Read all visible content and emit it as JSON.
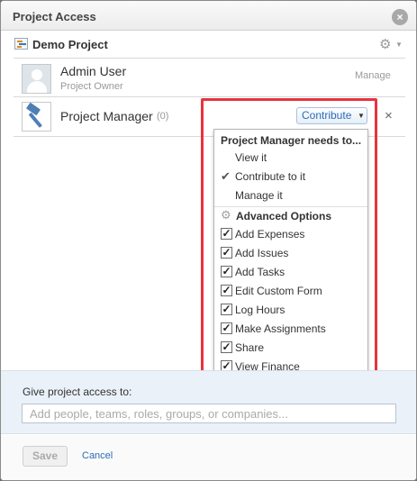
{
  "dialog": {
    "title": "Project Access",
    "close_glyph": "×"
  },
  "project": {
    "name": "Demo Project",
    "icon": "project-icon",
    "settings_icon": "gear-icon"
  },
  "members": [
    {
      "name": "Admin User",
      "subtitle": "Project Owner",
      "access": "Manage",
      "icon": "avatar-placeholder"
    },
    {
      "name": "Project Manager",
      "count": "(0)",
      "access": "Contribute",
      "icon": "hammer-icon",
      "remove_glyph": "×"
    }
  ],
  "menu": {
    "header": "Project Manager needs to...",
    "options": [
      {
        "label": "View it",
        "selected": false
      },
      {
        "label": "Contribute to it",
        "selected": true
      },
      {
        "label": "Manage it",
        "selected": false
      }
    ],
    "advanced_label": "Advanced Options",
    "advanced": [
      {
        "label": "Add Expenses",
        "checked": true
      },
      {
        "label": "Add Issues",
        "checked": true
      },
      {
        "label": "Add Tasks",
        "checked": true
      },
      {
        "label": "Edit Custom Form",
        "checked": true
      },
      {
        "label": "Log Hours",
        "checked": true
      },
      {
        "label": "Make Assignments",
        "checked": true
      },
      {
        "label": "Share",
        "checked": true
      },
      {
        "label": "View Finance",
        "checked": true
      }
    ]
  },
  "give_access": {
    "label": "Give project access to:",
    "placeholder": "Add people, teams, roles, groups, or companies..."
  },
  "footer": {
    "save_label": "Save",
    "cancel_label": "Cancel"
  },
  "colors": {
    "highlight": "#e8333d",
    "link": "#2d6db8",
    "panel": "#eaf1f9"
  }
}
